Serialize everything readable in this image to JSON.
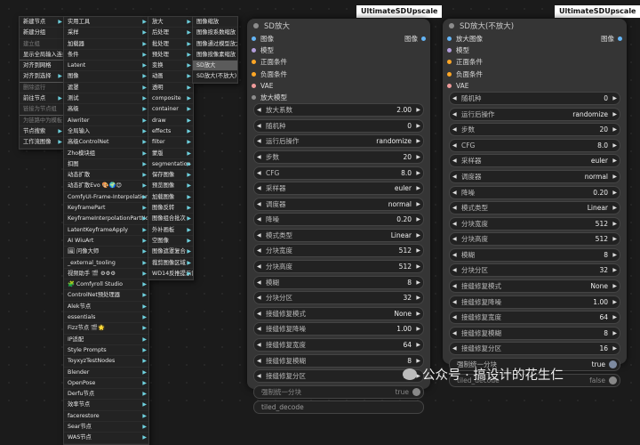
{
  "menu_root": [
    {
      "label": "新建节点",
      "arrow": true
    },
    {
      "label": "新建分组"
    },
    {
      "label": "建立组",
      "disabled": true
    },
    {
      "label": "显示全局输入连线",
      "sep": true
    },
    {
      "label": "对齐到网格"
    },
    {
      "label": "对齐到选择",
      "arrow": true,
      "sep": true
    },
    {
      "label": "删除运行",
      "disabled": true
    },
    {
      "label": "前往节点",
      "arrow": true
    },
    {
      "label": "链接为节点组",
      "disabled": true,
      "sep": true
    },
    {
      "label": "为链路中为模板",
      "disabled": true
    },
    {
      "label": "节点搜索",
      "arrow": true
    },
    {
      "label": "工作流图像",
      "arrow": true
    }
  ],
  "menu_categories": [
    {
      "label": "实用工具",
      "arrow": true
    },
    {
      "label": "采样",
      "arrow": true
    },
    {
      "label": "加载器",
      "arrow": true
    },
    {
      "label": "条件",
      "arrow": true
    },
    {
      "label": "Latent",
      "arrow": true
    },
    {
      "label": "图像",
      "arrow": true
    },
    {
      "label": "遮罩",
      "arrow": true
    },
    {
      "label": "测试",
      "arrow": true
    },
    {
      "label": "高级",
      "arrow": true
    },
    {
      "label": "Aiwriter",
      "arrow": true
    },
    {
      "label": "全局输入",
      "arrow": true
    },
    {
      "label": "高级ControlNet",
      "arrow": true
    },
    {
      "label": "Zho模块组",
      "arrow": true
    },
    {
      "label": "扣图",
      "arrow": true
    },
    {
      "label": "动态扩散",
      "arrow": true
    },
    {
      "label": "动态扩散Evo 🎨🌍😊",
      "arrow": true
    },
    {
      "label": "ComfyUI-Frame-Interpolation",
      "arrow": true
    },
    {
      "label": "KeyframePart",
      "arrow": true
    },
    {
      "label": "KeyframeInterpolationPartNode",
      "arrow": true
    },
    {
      "label": "LatentKeyframeApply",
      "arrow": true
    },
    {
      "label": "AI WiuArt",
      "arrow": true
    },
    {
      "label": "🖼 问像大师",
      "arrow": true
    },
    {
      "label": "_external_tooling",
      "arrow": true
    },
    {
      "label": "视频助手 🎬 ⚙⚙⚙",
      "arrow": true
    },
    {
      "label": "🧩 Comfyroll Studio",
      "arrow": true
    },
    {
      "label": "ControlNet预处理器",
      "arrow": true
    },
    {
      "label": "Alek节点",
      "arrow": true
    },
    {
      "label": "essentials",
      "arrow": true
    },
    {
      "label": "Fizz节点 🎬🌟",
      "arrow": true
    },
    {
      "label": "IP适配",
      "arrow": true
    },
    {
      "label": "Style Prompts",
      "arrow": true
    },
    {
      "label": "ToyxyzTestNodes",
      "arrow": true
    },
    {
      "label": "Blender",
      "arrow": true
    },
    {
      "label": "OpenPose",
      "arrow": true
    },
    {
      "label": "Derfu节点",
      "arrow": true
    },
    {
      "label": "效率节点",
      "arrow": true
    },
    {
      "label": "facerestore",
      "arrow": true
    },
    {
      "label": "Sear节点",
      "arrow": true
    },
    {
      "label": "WAS节点",
      "arrow": true
    }
  ],
  "menu_image": [
    {
      "label": "放大",
      "arrow": true
    },
    {
      "label": "后处理",
      "arrow": true
    },
    {
      "label": "批处理",
      "arrow": true
    },
    {
      "label": "预处理",
      "arrow": true
    },
    {
      "label": "变换",
      "arrow": true
    },
    {
      "label": "动画",
      "arrow": true
    },
    {
      "label": "透明",
      "arrow": true
    },
    {
      "label": "composite",
      "arrow": true
    },
    {
      "label": "container",
      "arrow": true
    },
    {
      "label": "draw",
      "arrow": true
    },
    {
      "label": "effects",
      "arrow": true
    },
    {
      "label": "filter",
      "arrow": true
    },
    {
      "label": "蒙版",
      "arrow": true
    },
    {
      "label": "segmentation",
      "arrow": true
    },
    {
      "label": "保存图像",
      "arrow": true
    },
    {
      "label": "预览图像",
      "arrow": true
    },
    {
      "label": "加载图像",
      "arrow": true
    },
    {
      "label": "图像反转",
      "arrow": true
    },
    {
      "label": "图像组合批次",
      "arrow": true
    },
    {
      "label": "外补画板",
      "arrow": true
    },
    {
      "label": "空图像",
      "arrow": true
    },
    {
      "label": "图像遮罩复合",
      "arrow": true
    },
    {
      "label": "裁剪图像区域",
      "arrow": true
    },
    {
      "label": "WD14反推提示词",
      "arrow": true
    }
  ],
  "menu_upscale": [
    {
      "label": "图像缩放"
    },
    {
      "label": "图像按系数缩放"
    },
    {
      "label": "图像通过模型放大"
    },
    {
      "label": "图像按像素缩放"
    },
    {
      "label": "SD放大",
      "highlight": true
    },
    {
      "label": "SD放大(不放大)"
    }
  ],
  "node1": {
    "tag": "UltimateSDUpscale",
    "title": "SD放大",
    "inputs": [
      {
        "label": "图像",
        "color": "#64b5f6",
        "out": "图像"
      },
      {
        "label": "模型",
        "color": "#b39ddb"
      },
      {
        "label": "正面条件",
        "color": "#ffa726"
      },
      {
        "label": "负面条件",
        "color": "#ffa726"
      },
      {
        "label": "VAE",
        "color": "#ef9a9a"
      },
      {
        "label": "放大模型",
        "color": "#8c8c8c"
      }
    ],
    "widgets": [
      {
        "label": "放大系数",
        "value": "2.00"
      },
      {
        "label": "随机种",
        "value": "0"
      },
      {
        "label": "运行后操作",
        "value": "randomize"
      },
      {
        "label": "步数",
        "value": "20"
      },
      {
        "label": "CFG",
        "value": "8.0"
      },
      {
        "label": "采样器",
        "value": "euler"
      },
      {
        "label": "调度器",
        "value": "normal"
      },
      {
        "label": "降噪",
        "value": "0.20"
      },
      {
        "label": "模式类型",
        "value": "Linear"
      },
      {
        "label": "分块宽度",
        "value": "512"
      },
      {
        "label": "分块高度",
        "value": "512"
      },
      {
        "label": "模糊",
        "value": "8"
      },
      {
        "label": "分块分区",
        "value": "32"
      },
      {
        "label": "接缝修复模式",
        "value": "None"
      },
      {
        "label": "接缝修复降噪",
        "value": "1.00"
      },
      {
        "label": "接缝修复宽度",
        "value": "64"
      },
      {
        "label": "接缝修复模糊",
        "value": "8"
      },
      {
        "label": "接缝修复分区",
        "value": "16"
      }
    ],
    "toggle": {
      "label": "强制统一分块",
      "value": "true"
    },
    "text": {
      "label": "tiled_decode"
    }
  },
  "node2": {
    "tag": "UltimateSDUpscale",
    "title": "SD放大(不放大)",
    "inputs": [
      {
        "label": "放大图像",
        "color": "#64b5f6",
        "out": "图像"
      },
      {
        "label": "模型",
        "color": "#b39ddb"
      },
      {
        "label": "正面条件",
        "color": "#ffa726"
      },
      {
        "label": "负面条件",
        "color": "#ffa726"
      },
      {
        "label": "VAE",
        "color": "#ef9a9a"
      }
    ],
    "widgets": [
      {
        "label": "随机种",
        "value": "0"
      },
      {
        "label": "运行后操作",
        "value": "randomize"
      },
      {
        "label": "步数",
        "value": "20"
      },
      {
        "label": "CFG",
        "value": "8.0"
      },
      {
        "label": "采样器",
        "value": "euler"
      },
      {
        "label": "调度器",
        "value": "normal"
      },
      {
        "label": "降噪",
        "value": "0.20"
      },
      {
        "label": "模式类型",
        "value": "Linear"
      },
      {
        "label": "分块宽度",
        "value": "512"
      },
      {
        "label": "分块高度",
        "value": "512"
      },
      {
        "label": "模糊",
        "value": "8"
      },
      {
        "label": "分块分区",
        "value": "32"
      },
      {
        "label": "接缝修复模式",
        "value": "None"
      },
      {
        "label": "接缝修复降噪",
        "value": "1.00"
      },
      {
        "label": "接缝修复宽度",
        "value": "64"
      },
      {
        "label": "接缝修复模糊",
        "value": "8"
      },
      {
        "label": "接缝修复分区",
        "value": "16"
      }
    ],
    "toggle": {
      "label": "强制统一分块",
      "value": "true"
    },
    "toggle2": {
      "label": "tiled_decode",
      "value": "false"
    }
  },
  "watermark": "公众号 · 搞设计的花生仁"
}
